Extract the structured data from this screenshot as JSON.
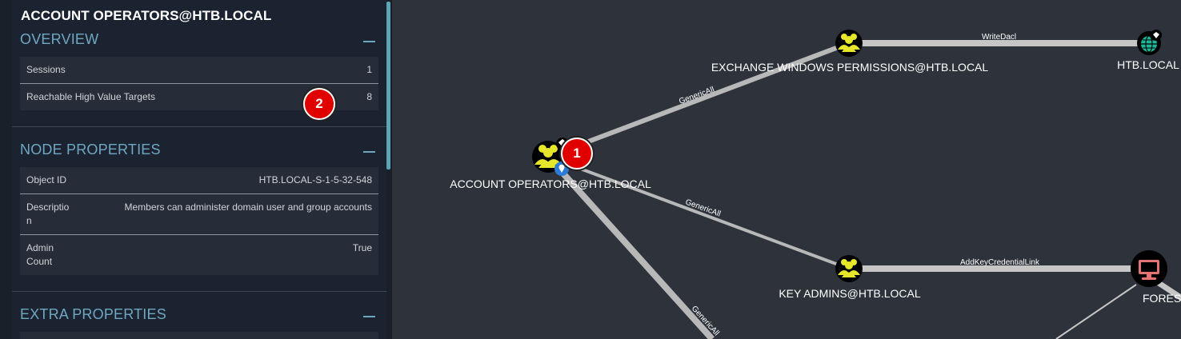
{
  "panel": {
    "title": "ACCOUNT OPERATORS@HTB.LOCAL",
    "overview": {
      "heading": "OVERVIEW",
      "rows": [
        {
          "key": "Sessions",
          "value": "1"
        },
        {
          "key": "Reachable High Value Targets",
          "value": "8"
        }
      ]
    },
    "node_properties": {
      "heading": "NODE PROPERTIES",
      "rows": [
        {
          "key": "Object ID",
          "value": "HTB.LOCAL-S-1-5-32-548"
        },
        {
          "key_line1": "Descriptio",
          "key_line2": "n",
          "value": "Members can administer domain user and group accounts"
        },
        {
          "key_line1": "Admin",
          "key_line2": "Count",
          "value": "True"
        }
      ]
    },
    "extra_properties": {
      "heading": "EXTRA PROPERTIES"
    }
  },
  "graph": {
    "nodes": {
      "account_operators": "ACCOUNT OPERATORS@HTB.LOCAL",
      "exchange_windows_permissions": "EXCHANGE WINDOWS PERMISSIONS@HTB.LOCAL",
      "htb_local": "HTB.LOCAL",
      "key_admins": "KEY ADMINS@HTB.LOCAL",
      "forest": "FOREST.HTB.LOC"
    },
    "edges": {
      "genericall_1": "GenericAll",
      "genericall_2": "GenericAll",
      "genericall_3": "GenericAll",
      "writedacl": "WriteDacl",
      "addkeycredentiallink": "AddKeyCredentialLink"
    }
  },
  "annotations": {
    "badge_1": "1",
    "badge_2": "2"
  },
  "colors": {
    "background": "#2e333b",
    "panel": "#1c2330",
    "accent": "#6fa7c2",
    "group_node": "#e6e62a",
    "computer_node": "#e57373",
    "domain_node": "#1db89a",
    "badge": "#e00000"
  },
  "icons": [
    "group-icon",
    "domain-globe-icon",
    "computer-icon",
    "high-value-diamond-icon",
    "owned-location-icon",
    "collapse-minus-icon"
  ]
}
